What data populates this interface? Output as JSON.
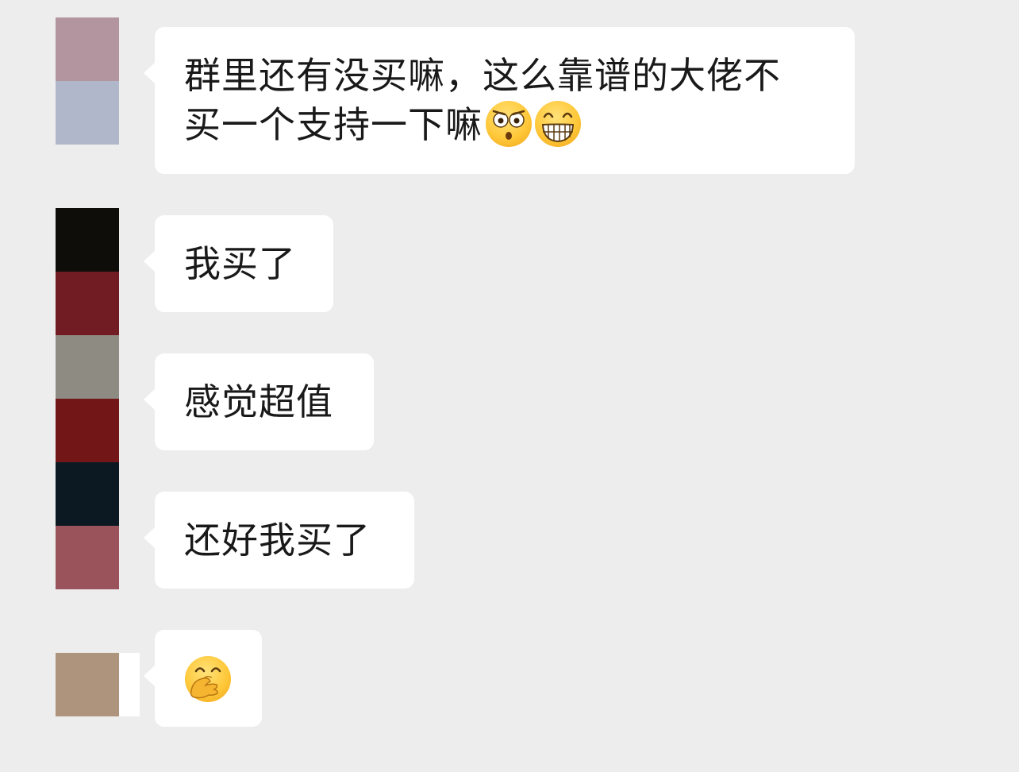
{
  "messages": [
    {
      "text": "群里还有没买嘛，这么靠谱的大佬不\n买一个支持一下嘛",
      "emojis": [
        "flushed-face-icon",
        "grinning-face-icon"
      ],
      "avatar_colors": [
        "#b2959f",
        "#b1b7ca"
      ]
    },
    {
      "text": "我买了",
      "avatar_colors": [
        "#0e0d09",
        "#711c22"
      ]
    },
    {
      "text": "感觉超值",
      "avatar_colors": [
        "#8e8b83",
        "#731618"
      ]
    },
    {
      "text": "还好我买了",
      "avatar_colors": [
        "#0c1922",
        "#9a525b"
      ]
    },
    {
      "text": "",
      "emojis": [
        "face-with-hand-over-mouth-icon"
      ],
      "avatar_colors": [
        "#ae947d"
      ]
    }
  ],
  "theme": {
    "background": "#ededed",
    "bubble": "#ffffff",
    "text": "#191919"
  }
}
